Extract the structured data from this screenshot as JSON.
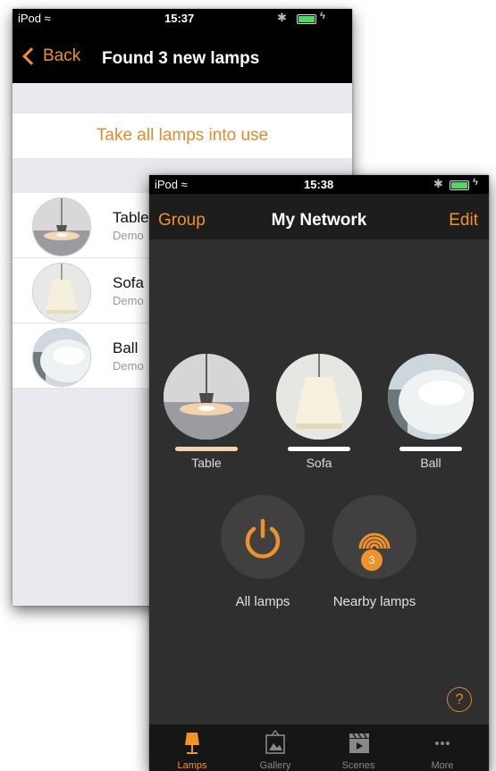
{
  "back_screen": {
    "status": {
      "carrier": "iPod",
      "time": "15:37"
    },
    "nav": {
      "back_label": "Back",
      "title": "Found 3 new lamps"
    },
    "take_all_label": "Take all lamps into use",
    "new_lamps": [
      {
        "name": "Table",
        "sub": "Demo"
      },
      {
        "name": "Sofa",
        "sub": "Demo"
      },
      {
        "name": "Ball",
        "sub": "Demo"
      }
    ]
  },
  "front_screen": {
    "status": {
      "carrier": "iPod",
      "time": "15:38"
    },
    "nav": {
      "left_label": "Group",
      "title": "My Network",
      "right_label": "Edit"
    },
    "lamps": [
      {
        "name": "Table",
        "bar_color": "#f4d2b0"
      },
      {
        "name": "Sofa",
        "bar_color": "#ffffff"
      },
      {
        "name": "Ball",
        "bar_color": "#ffffff"
      }
    ],
    "all_lamps_label": "All lamps",
    "nearby_lamps_label": "Nearby lamps",
    "nearby_count": "3",
    "help_label": "?",
    "tabs": [
      {
        "label": "Lamps",
        "icon": "lamp-icon",
        "active": true
      },
      {
        "label": "Gallery",
        "icon": "gallery-icon",
        "active": false
      },
      {
        "label": "Scenes",
        "icon": "scenes-icon",
        "active": false
      },
      {
        "label": "More",
        "icon": "more-icon",
        "active": false
      }
    ]
  },
  "colors": {
    "accent": "#f0922a",
    "dark_bg": "#2f2f2f",
    "light_bg": "#e9e9ee"
  }
}
